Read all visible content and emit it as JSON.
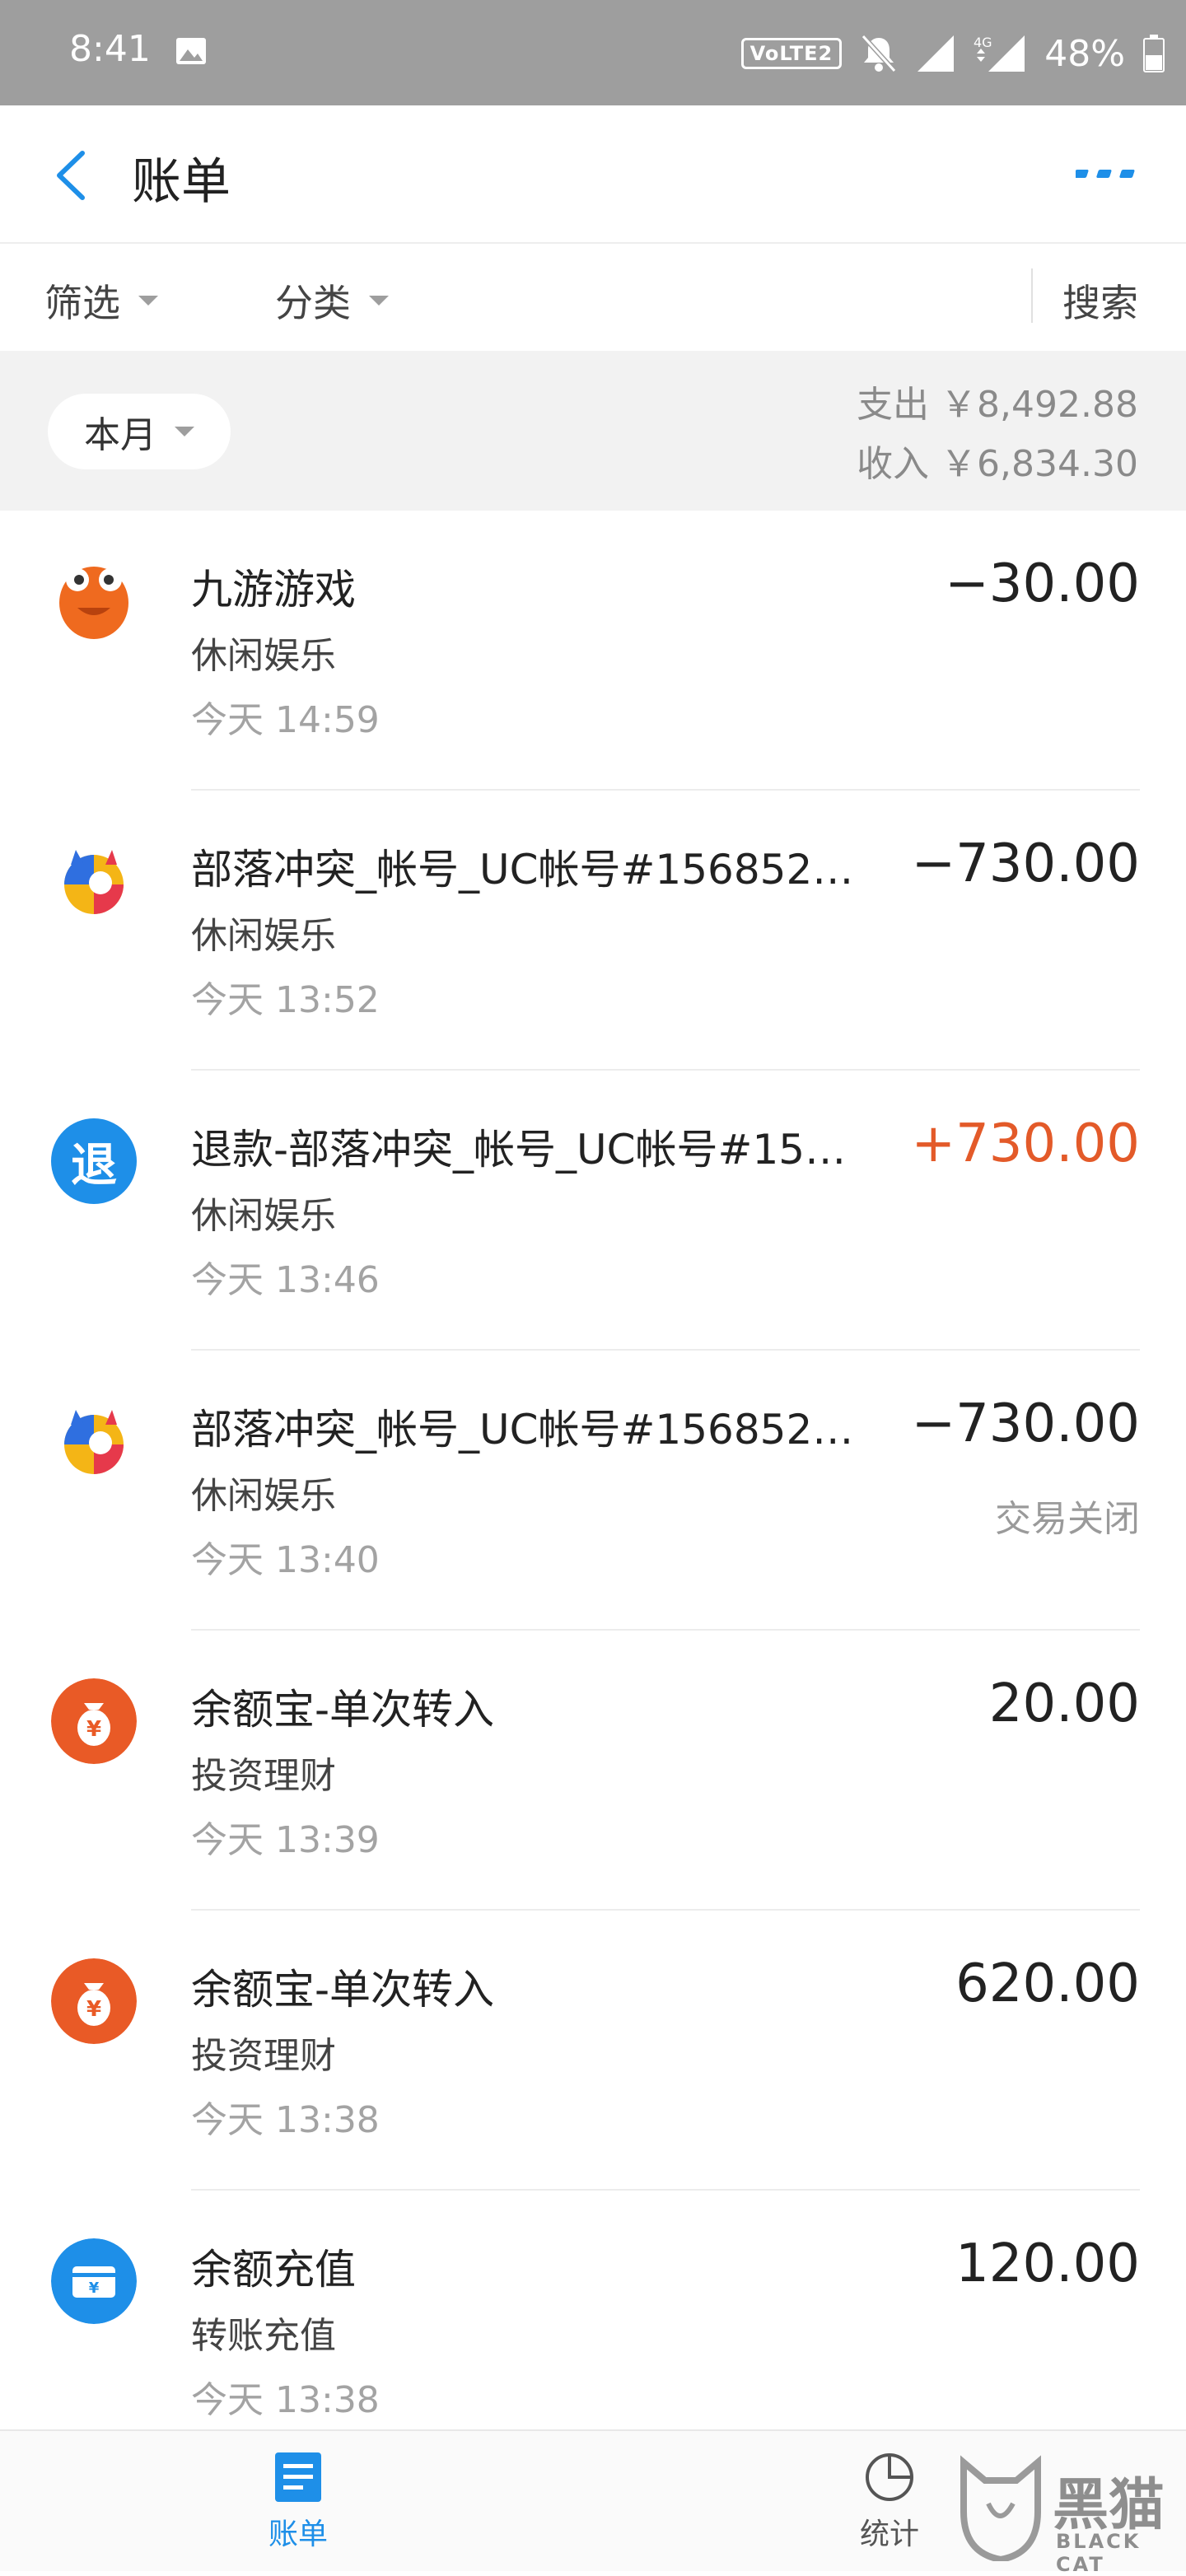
{
  "status_bar": {
    "time": "8:41",
    "volte": "VoLTE2",
    "network": "4G",
    "battery": "48%"
  },
  "header": {
    "title": "账单"
  },
  "filters": {
    "filter_label": "筛选",
    "category_label": "分类",
    "search_label": "搜索"
  },
  "summary": {
    "month_label": "本月",
    "expense": "支出 ￥8,492.88",
    "income": "收入 ￥6,834.30"
  },
  "transactions": [
    {
      "name": "九游游戏",
      "category": "休闲娱乐",
      "day": "今天",
      "time": "14:59",
      "amount": "−30.00",
      "status": "",
      "icon": "jiuyou-game-icon"
    },
    {
      "name": "部落冲突_帐号_UC帐号#156852…",
      "category": "休闲娱乐",
      "day": "今天",
      "time": "13:52",
      "amount": "−730.00",
      "status": "",
      "icon": "uc-game-icon"
    },
    {
      "name": "退款-部落冲突_帐号_UC帐号#15…",
      "category": "休闲娱乐",
      "day": "今天",
      "time": "13:46",
      "amount": "+730.00",
      "status": "",
      "icon": "refund-icon",
      "icon_text": "退"
    },
    {
      "name": "部落冲突_帐号_UC帐号#156852…",
      "category": "休闲娱乐",
      "day": "今天",
      "time": "13:40",
      "amount": "−730.00",
      "status": "交易关闭",
      "icon": "uc-game-icon"
    },
    {
      "name": "余额宝-单次转入",
      "category": "投资理财",
      "day": "今天",
      "time": "13:39",
      "amount": "20.00",
      "status": "",
      "icon": "yuebao-icon"
    },
    {
      "name": "余额宝-单次转入",
      "category": "投资理财",
      "day": "今天",
      "time": "13:38",
      "amount": "620.00",
      "status": "",
      "icon": "yuebao-icon"
    },
    {
      "name": "余额充值",
      "category": "转账充值",
      "day": "今天",
      "time": "13:38",
      "amount": "120.00",
      "status": "",
      "icon": "balance-recharge-icon"
    }
  ],
  "tabs": {
    "bill": "账单",
    "stats": "统计"
  },
  "watermark": {
    "text": "黑猫",
    "sub": "BLACK CAT"
  },
  "colors": {
    "accent": "#1e8fe8",
    "income": "#e35a29",
    "status_bar": "#9e9e9e"
  }
}
